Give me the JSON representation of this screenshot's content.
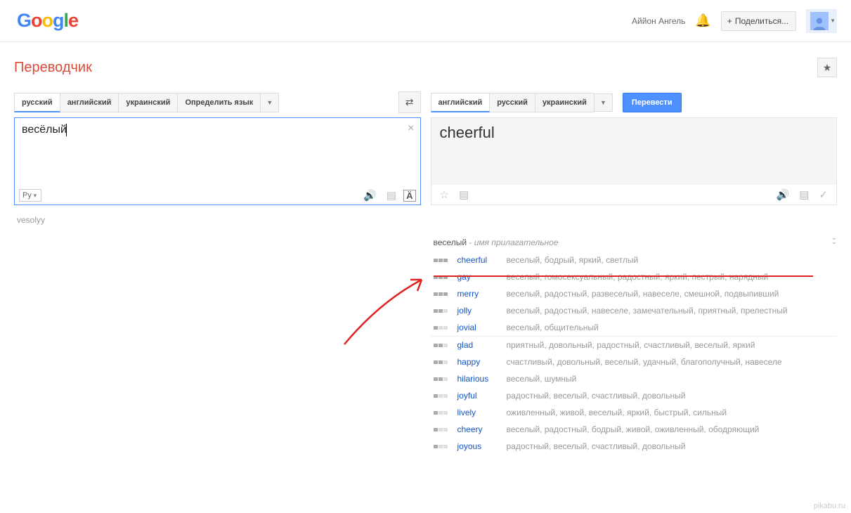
{
  "header": {
    "username": "Аййон Ангель",
    "share_label": "Поделиться..."
  },
  "app_title": "Переводчик",
  "source": {
    "langs": [
      "русский",
      "английский",
      "украинский"
    ],
    "detect_label": "Определить язык",
    "active_index": 0,
    "text": "весёлый",
    "keyboard_label": "Ру",
    "translit": "vesolyy"
  },
  "target": {
    "langs": [
      "английский",
      "русский",
      "украинский"
    ],
    "active_index": 0,
    "translate_label": "Перевести",
    "text": "cheerful"
  },
  "dictionary": {
    "headword": "веселый",
    "pos": "имя прилагательное",
    "groups": [
      [
        {
          "word": "cheerful",
          "freq": 3,
          "means": "веселый, бодрый, яркий, светлый"
        },
        {
          "word": "gay",
          "freq": 3,
          "means": "веселый, гомосексуальный, радостный, яркий, пестрый, нарядный"
        },
        {
          "word": "merry",
          "freq": 3,
          "means": "веселый, радостный, развеселый, навеселе, смешной, подвыпивший"
        },
        {
          "word": "jolly",
          "freq": 2,
          "means": "веселый, радостный, навеселе, замечательный, приятный, прелестный"
        },
        {
          "word": "jovial",
          "freq": 1,
          "means": "веселый, общительный"
        }
      ],
      [
        {
          "word": "glad",
          "freq": 2,
          "means": "приятный, довольный, радостный, счастливый, веселый, яркий"
        },
        {
          "word": "happy",
          "freq": 2,
          "means": "счастливый, довольный, веселый, удачный, благополучный, навеселе"
        },
        {
          "word": "hilarious",
          "freq": 2,
          "means": "веселый, шумный"
        },
        {
          "word": "joyful",
          "freq": 1,
          "means": "радостный, веселый, счастливый, довольный"
        },
        {
          "word": "lively",
          "freq": 1,
          "means": "оживленный, живой, веселый, яркий, быстрый, сильный"
        },
        {
          "word": "cheery",
          "freq": 1,
          "means": "веселый, радостный, бодрый, живой, оживленный, ободряющий"
        },
        {
          "word": "joyous",
          "freq": 1,
          "means": "радостный, веселый, счастливый, довольный"
        }
      ]
    ]
  },
  "watermark": "pikabu.ru"
}
